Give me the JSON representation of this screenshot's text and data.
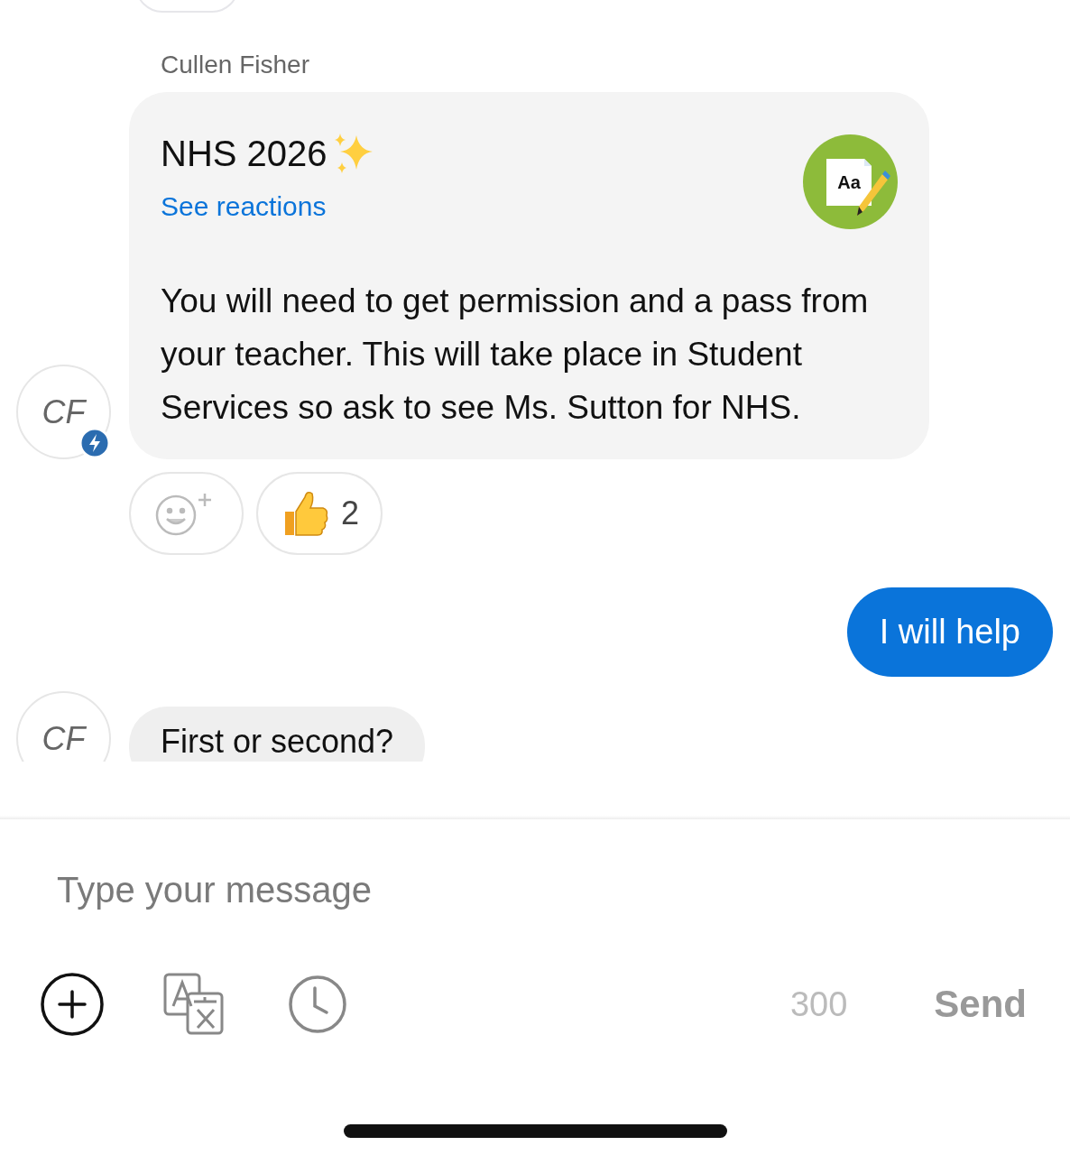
{
  "messages": [
    {
      "kind": "incoming",
      "sender": "Cullen Fisher",
      "avatar": "CF",
      "title": "NHS 2026",
      "link": "See reactions",
      "card_icon_label": "Aa",
      "body": "You will need to get permission and a pass from your teacher. This will take place in Student Services so ask to see Ms. Sutton for NHS.",
      "reactions": [
        {
          "kind": "add"
        },
        {
          "kind": "thumbs",
          "count": "2"
        }
      ]
    },
    {
      "kind": "outgoing",
      "text": "I will help"
    },
    {
      "kind": "incoming_partial",
      "avatar": "CF",
      "text": "First or second?"
    }
  ],
  "composer": {
    "placeholder": "Type your message",
    "counter": "300",
    "send": "Send",
    "send_disabled": true
  }
}
